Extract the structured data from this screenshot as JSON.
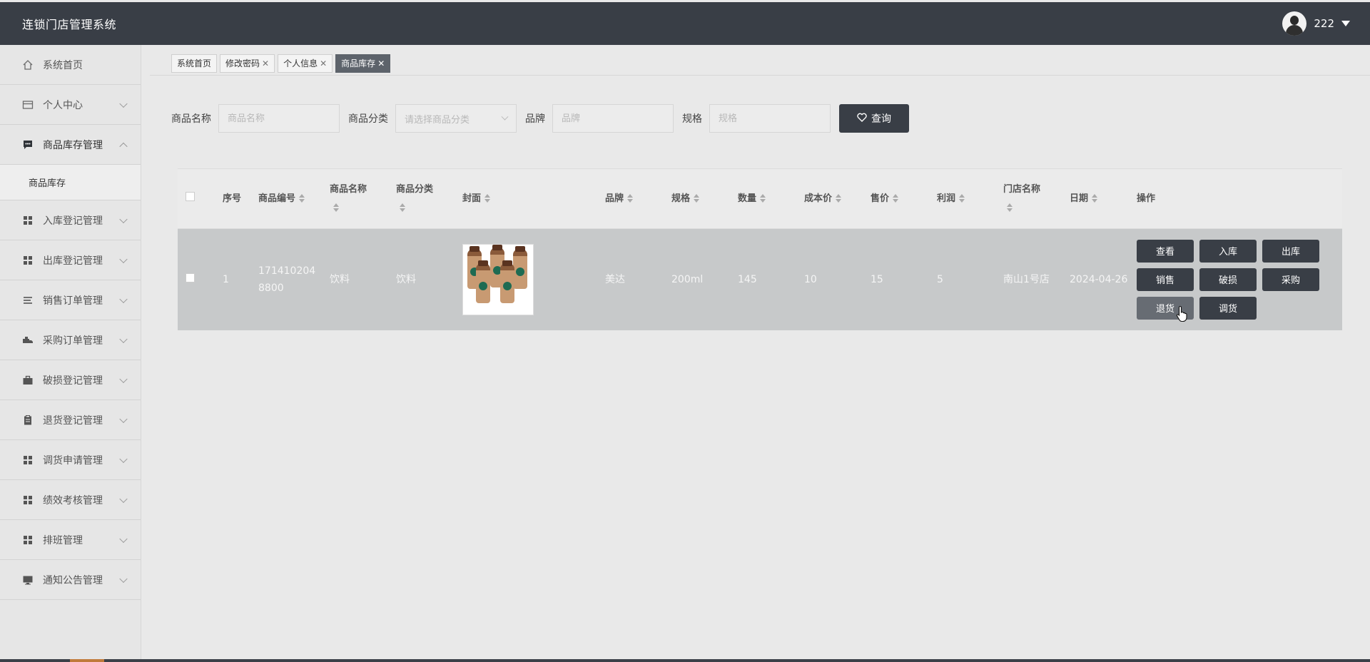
{
  "app": {
    "title": "连锁门店管理系统"
  },
  "user": {
    "name": "222"
  },
  "sidebar": {
    "items": [
      {
        "label": "系统首页",
        "icon": "home-icon"
      },
      {
        "label": "个人中心",
        "icon": "card-icon"
      },
      {
        "label": "商品库存管理",
        "icon": "chat-icon",
        "open": true,
        "children": [
          {
            "label": "商品库存"
          }
        ]
      },
      {
        "label": "入库登记管理",
        "icon": "grid-icon"
      },
      {
        "label": "出库登记管理",
        "icon": "grid-icon"
      },
      {
        "label": "销售订单管理",
        "icon": "list-icon"
      },
      {
        "label": "采购订单管理",
        "icon": "truck-icon"
      },
      {
        "label": "破损登记管理",
        "icon": "briefcase-icon"
      },
      {
        "label": "退货登记管理",
        "icon": "clipboard-icon"
      },
      {
        "label": "调货申请管理",
        "icon": "grid-icon"
      },
      {
        "label": "绩效考核管理",
        "icon": "grid-icon"
      },
      {
        "label": "排班管理",
        "icon": "grid-icon"
      },
      {
        "label": "通知公告管理",
        "icon": "monitor-icon"
      }
    ]
  },
  "tabs": [
    {
      "label": "系统首页",
      "closable": false,
      "active": false
    },
    {
      "label": "修改密码",
      "closable": true,
      "active": false
    },
    {
      "label": "个人信息",
      "closable": true,
      "active": false
    },
    {
      "label": "商品库存",
      "closable": true,
      "active": true
    }
  ],
  "search": {
    "name_label": "商品名称",
    "name_placeholder": "商品名称",
    "category_label": "商品分类",
    "category_placeholder": "请选择商品分类",
    "brand_label": "品牌",
    "brand_placeholder": "品牌",
    "spec_label": "规格",
    "spec_placeholder": "规格",
    "query_label": "查询"
  },
  "table": {
    "headers": {
      "index": "序号",
      "code": "商品编号",
      "name": "商品名称",
      "category": "商品分类",
      "cover": "封面",
      "brand": "品牌",
      "spec": "规格",
      "qty": "数量",
      "cost": "成本价",
      "price": "售价",
      "profit": "利润",
      "store": "门店名称",
      "date": "日期",
      "ops": "操作"
    },
    "rows": [
      {
        "index": "1",
        "code": "1714102048800",
        "name": "饮料",
        "category": "饮料",
        "brand": "美达",
        "spec": "200ml",
        "qty": "145",
        "cost": "10",
        "price": "15",
        "profit": "5",
        "store": "南山1号店",
        "date": "2024-04-26"
      }
    ],
    "actions": [
      "查看",
      "入库",
      "出库",
      "销售",
      "破损",
      "采购",
      "退货",
      "调货"
    ]
  },
  "colors": {
    "header_bg": "#393e46",
    "button_bg": "#393e46",
    "row_bg": "#c7c9ca",
    "accent": "#c07a3b"
  }
}
